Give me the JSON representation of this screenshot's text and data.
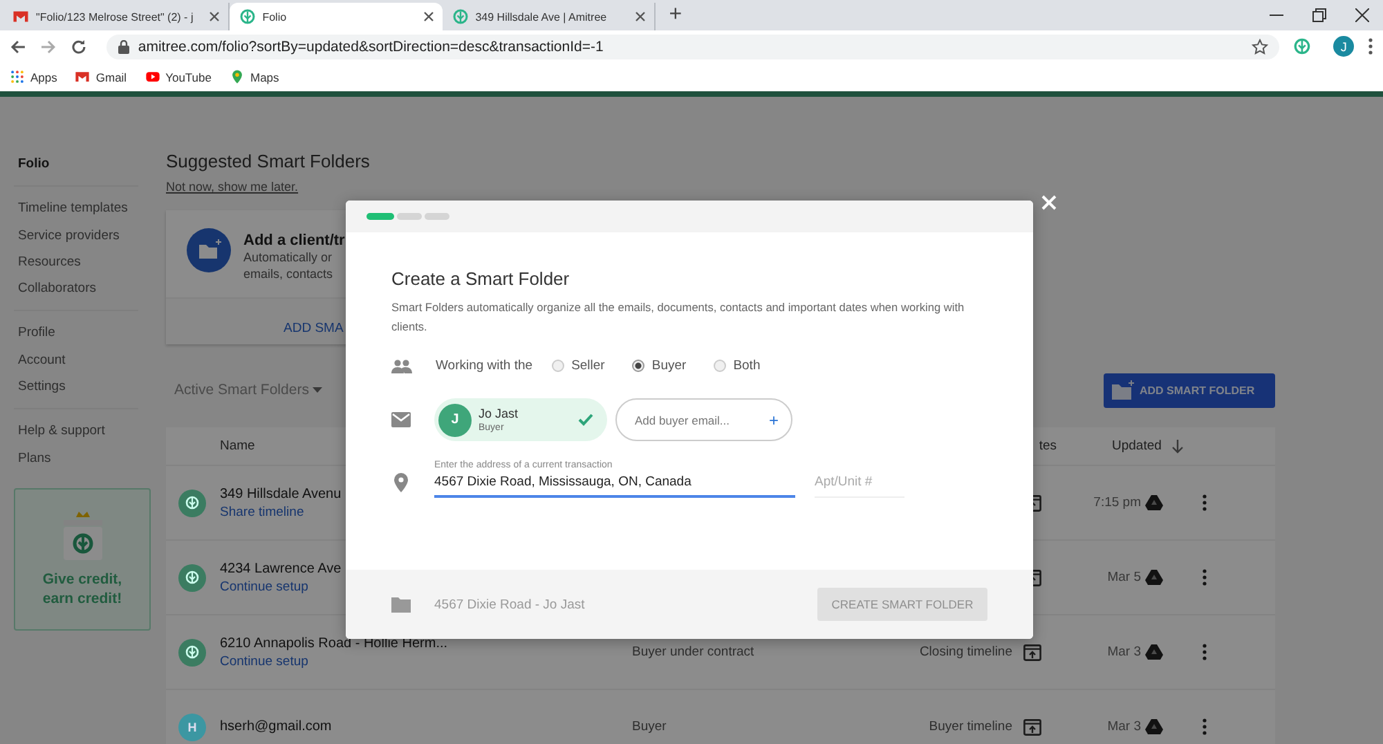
{
  "browser": {
    "tabs": [
      {
        "title": "\"Folio/123 Melrose Street\" (2) - j",
        "selected": false
      },
      {
        "title": "Folio",
        "selected": true
      },
      {
        "title": "349 Hillsdale Ave | Amitree",
        "selected": false
      }
    ],
    "new_tab": "+",
    "url": "amitree.com/folio?sortBy=updated&sortDirection=desc&transactionId=-1",
    "profile_initial": "J",
    "bookmarks": [
      {
        "label": "Apps"
      },
      {
        "label": "Gmail"
      },
      {
        "label": "YouTube"
      },
      {
        "label": "Maps"
      }
    ]
  },
  "sidebar": {
    "groups": [
      [
        {
          "label": "Folio",
          "selected": true
        }
      ],
      [
        {
          "label": "Timeline templates",
          "selected": false
        },
        {
          "label": "Service providers",
          "selected": false
        },
        {
          "label": "Resources",
          "selected": false
        },
        {
          "label": "Collaborators",
          "selected": false
        }
      ],
      [
        {
          "label": "Profile",
          "selected": false
        },
        {
          "label": "Account",
          "selected": false
        },
        {
          "label": "Settings",
          "selected": false
        }
      ],
      [
        {
          "label": "Help & support",
          "selected": false
        },
        {
          "label": "Plans",
          "selected": false
        }
      ]
    ],
    "promo": "Give credit, earn credit!"
  },
  "suggested": {
    "title": "Suggested Smart Folders",
    "dismiss_link": "Not now, show me later.",
    "card": {
      "title": "Add a client/tr",
      "lines": [
        "Automatically or",
        "emails, contacts"
      ],
      "action": "ADD SMA"
    }
  },
  "folders": {
    "filter": "Active Smart Folders",
    "add_button": "ADD SMART FOLDER",
    "columns": {
      "name": "Name",
      "timeline": "tes",
      "updated": "Updated"
    },
    "rows": [
      {
        "kind": "icon",
        "color": "#3b7c61",
        "name": "349 Hillsdale Avenu",
        "action": "Share timeline",
        "updated": "7:15 pm"
      },
      {
        "kind": "icon",
        "color": "#3b7c61",
        "name": "4234 Lawrence Ave",
        "action": "Continue setup",
        "updated": "Mar 5"
      },
      {
        "kind": "icon",
        "color": "#3b7c61",
        "name": "6210 Annapolis Road - Hollie Herm...",
        "action": "Continue setup",
        "type": "Buyer under contract",
        "timeline": "Closing timeline",
        "updated": "Mar 3"
      },
      {
        "kind": "letter",
        "letter": "H",
        "color": "#3c97a2",
        "name": "hserh@gmail.com",
        "type": "Buyer",
        "timeline": "Buyer timeline",
        "updated": "Mar 3"
      }
    ]
  },
  "modal": {
    "steps": [
      {
        "done": true
      },
      {
        "done": false
      },
      {
        "done": false
      }
    ],
    "title": "Create a Smart Folder",
    "description": "Smart Folders automatically organize all the emails, documents, contacts and important dates when working with clients.",
    "role": {
      "label": "Working with the",
      "options": [
        {
          "label": "Seller",
          "selected": false
        },
        {
          "label": "Buyer",
          "selected": true
        },
        {
          "label": "Both",
          "selected": false
        }
      ]
    },
    "contact": {
      "initial": "J",
      "name": "Jo Jast",
      "role": "Buyer",
      "verified": true
    },
    "email_field": {
      "placeholder": "Add buyer email...",
      "add": "+"
    },
    "address": {
      "label": "Enter the address of a current transaction",
      "value": "4567 Dixie Road, Mississauga, ON, Canada"
    },
    "unit": {
      "placeholder": "Apt/Unit #"
    },
    "folder_name": "4567 Dixie Road - Jo Jast",
    "create_button": {
      "label": "CREATE SMART FOLDER",
      "disabled": true
    }
  }
}
